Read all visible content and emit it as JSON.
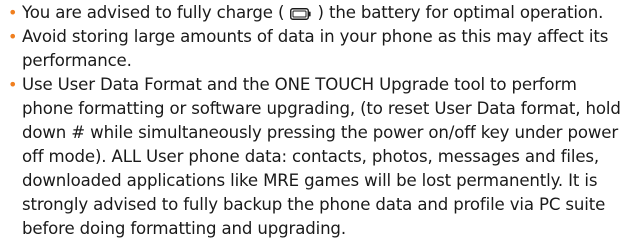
{
  "bullets": [
    {
      "before": "You are advised to fully charge (",
      "icon": "battery-icon",
      "after": ") the battery for optimal operation."
    },
    {
      "text": "Avoid storing large amounts of data in your phone as this may affect its performance."
    },
    {
      "text": "Use User Data Format and the ONE TOUCH Upgrade tool to perform phone formatting or software upgrading, (to reset User Data format, hold down # while simultaneously pressing the power on/off key under power off mode). ALL User phone data: contacts, photos, messages and files, downloaded applications like MRE games will be lost permanently. It is strongly advised to fully backup the phone data and profile via PC suite before doing formatting and upgrading."
    }
  ],
  "colors": {
    "bullet": "#f07f1f",
    "text": "#1a1a1a"
  }
}
